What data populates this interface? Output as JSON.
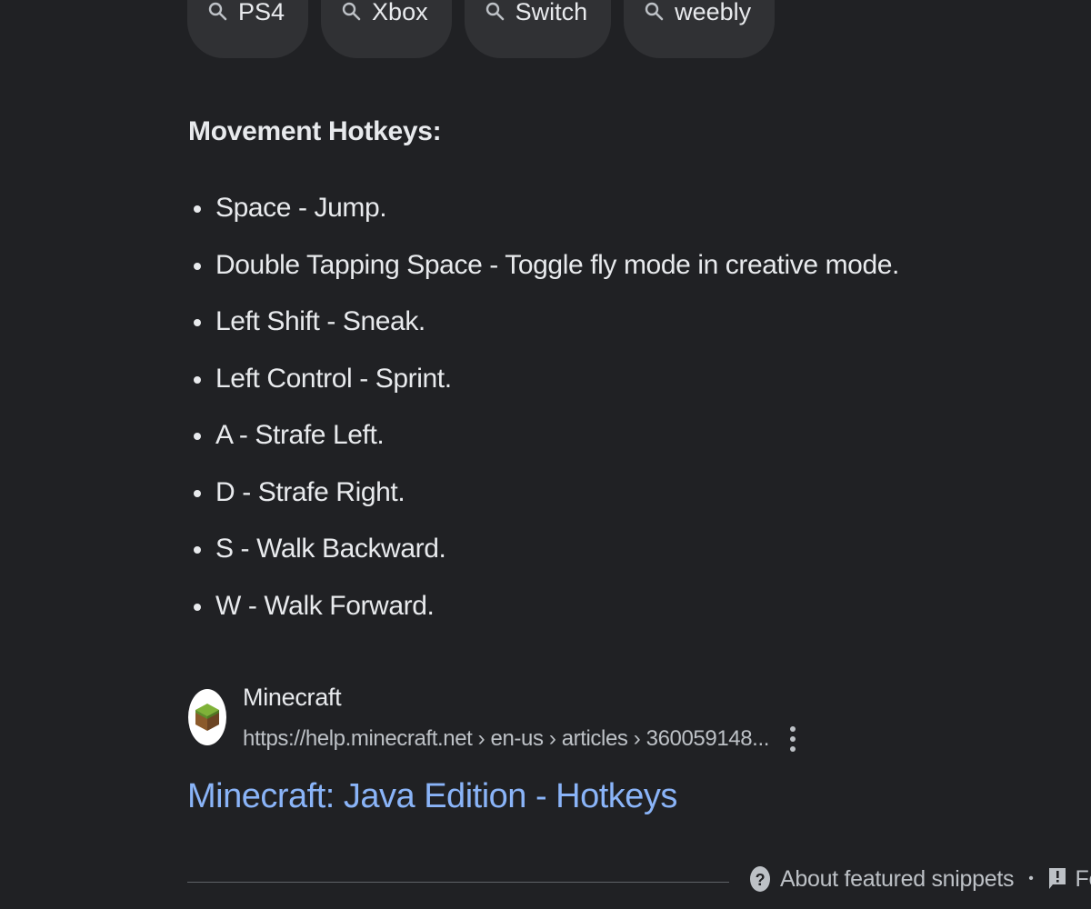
{
  "chips": [
    {
      "label": "PS4",
      "icon": "search-icon"
    },
    {
      "label": "Xbox",
      "icon": "search-icon"
    },
    {
      "label": "Switch",
      "icon": "search-icon"
    },
    {
      "label": "weebly",
      "icon": "search-icon"
    }
  ],
  "snippet": {
    "heading": "Movement Hotkeys:",
    "items": [
      "Space - Jump.",
      "Double Tapping Space - Toggle fly mode in creative mode.",
      "Left Shift - Sneak.",
      "Left Control - Sprint.",
      "A - Strafe Left.",
      "D - Strafe Right.",
      "S - Walk Backward.",
      "W - Walk Forward."
    ]
  },
  "source": {
    "site_name": "Minecraft",
    "url": "https://help.minecraft.net › en-us › articles › 360059148...",
    "favicon_icon": "minecraft-grass-block-icon",
    "more_icon": "more-vert-icon"
  },
  "result": {
    "title": "Minecraft: Java Edition - Hotkeys"
  },
  "footer": {
    "about_label": "About featured snippets",
    "separator": "•",
    "feedback_label": "Feedback"
  },
  "colors": {
    "background": "#202124",
    "chip_background": "#303134",
    "text": "#e8eaed",
    "secondary_text": "#bdc1c6",
    "link": "#8ab4f8"
  }
}
